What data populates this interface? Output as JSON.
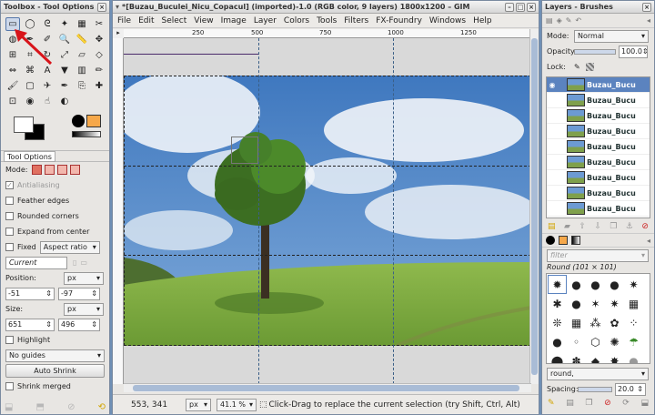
{
  "toolbox": {
    "title": "Toolbox - Tool Options",
    "tool_icons": [
      "rect-select-icon",
      "ellipse-select-icon",
      "free-select-icon",
      "fuzzy-select-icon",
      "select-by-color-icon",
      "scissors-icon",
      "foreground-select-icon",
      "paths-icon",
      "color-picker-icon",
      "zoom-icon",
      "measure-icon",
      "move-icon",
      "align-icon",
      "crop-icon",
      "rotate-icon",
      "scale-icon",
      "shear-icon",
      "perspective-icon",
      "flip-icon",
      "cage-icon",
      "text-icon",
      "bucket-fill-icon",
      "blend-icon",
      "pencil-icon",
      "paintbrush-icon",
      "eraser-icon",
      "airbrush-icon",
      "ink-icon",
      "clone-icon",
      "heal-icon",
      "perspective-clone-icon",
      "blur-icon",
      "smudge-icon",
      "dodge-burn-icon"
    ],
    "tool_options_tab": "Tool Options",
    "mode_label": "Mode:",
    "antialiasing": "Antialiasing",
    "feather_edges": "Feather edges",
    "rounded_corners": "Rounded corners",
    "expand_from_center": "Expand from center",
    "fixed_label": "Fixed",
    "fixed_value": "Aspect ratio",
    "current_value": "Current",
    "position_label": "Position:",
    "position_unit": "px",
    "position_x": "-51",
    "position_y": "-97",
    "size_label": "Size:",
    "size_unit": "px",
    "size_w": "651",
    "size_h": "496",
    "highlight": "Highlight",
    "guides_value": "No guides",
    "auto_shrink": "Auto Shrink",
    "shrink_merged": "Shrink merged"
  },
  "image_window": {
    "title": "*[Buzau_Buculei_Nicu_Copacul] (imported)-1.0 (RGB color, 9 layers) 1800x1200 – GIM",
    "menus": [
      "File",
      "Edit",
      "Select",
      "View",
      "Image",
      "Layer",
      "Colors",
      "Tools",
      "Filters",
      "FX-Foundry",
      "Windows",
      "Help"
    ],
    "ruler_ticks": [
      "250",
      "500",
      "750",
      "1000",
      "1250"
    ],
    "status_coords": "553, 341",
    "status_unit": "px",
    "zoom": "41.1 %",
    "status_message": "Click-Drag to replace the current selection (try Shift, Ctrl, Alt)"
  },
  "layers": {
    "title": "Layers - Brushes",
    "mode_label": "Mode:",
    "mode_value": "Normal",
    "opacity_label": "Opacity:",
    "opacity_value": "100.0",
    "lock_label": "Lock:",
    "layer_names": [
      "Buzau_Bucu",
      "Buzau_Bucu",
      "Buzau_Bucu",
      "Buzau_Bucu",
      "Buzau_Bucu",
      "Buzau_Bucu",
      "Buzau_Bucu",
      "Buzau_Bucu",
      "Buzau_Bucu"
    ],
    "filter_placeholder": "filter",
    "brush_name": "Round (101 × 101)",
    "brush_tag": "round,",
    "spacing_label": "Spacing:",
    "spacing_value": "20.0"
  },
  "colors": {
    "accent": "#5b83bf",
    "pattern": "#f6a84a",
    "sky": "#4f86c6",
    "grass": "#78a53f"
  }
}
